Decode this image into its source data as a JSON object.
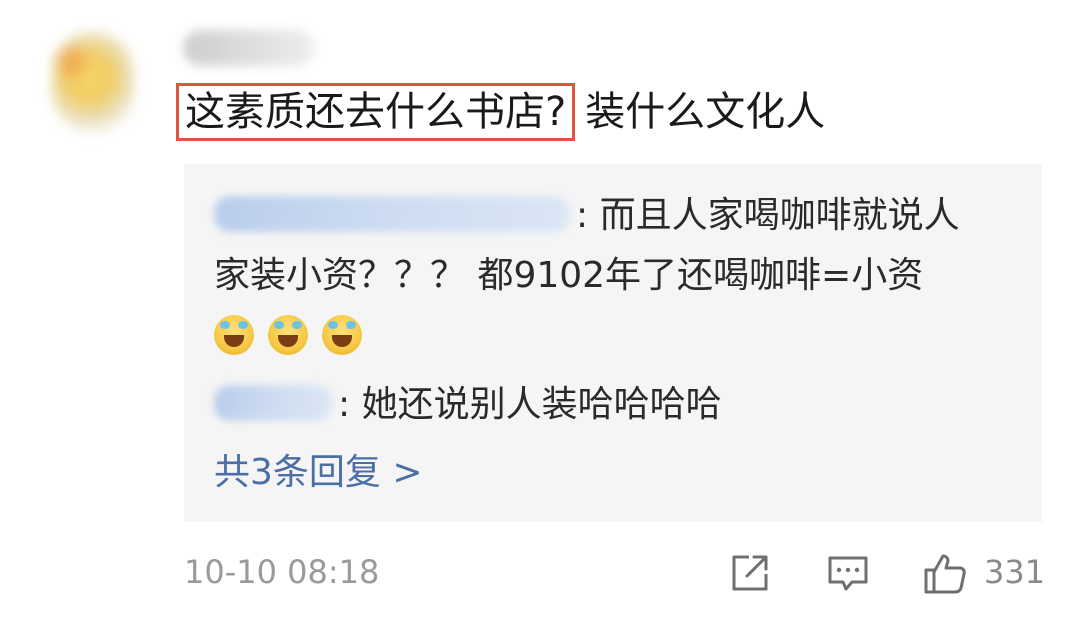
{
  "comment": {
    "highlighted_text": "这素质还去什么书店?",
    "rest_text": "装什么文化人",
    "timestamp": "10-10 08:18",
    "like_count": "331"
  },
  "replies": {
    "items": [
      {
        "text_line1": ": 而且人家喝咖啡就说人",
        "text_line2": "家装小资？？？ 都9102年了还喝咖啡=小资",
        "emoji_icons": [
          "laughing-crying-icon",
          "laughing-crying-icon",
          "laughing-crying-icon"
        ]
      },
      {
        "text": ": 她还说别人装哈哈哈哈"
      }
    ],
    "more_label": "共3条回复 >"
  },
  "icons": {
    "share": "share-icon",
    "reply": "comment-icon",
    "like": "thumbs-up-icon"
  },
  "colors": {
    "highlight_border": "#e0533e",
    "link": "#4a6fa5",
    "panel_bg": "#f5f5f5",
    "meta_text": "#9a9a9a"
  }
}
